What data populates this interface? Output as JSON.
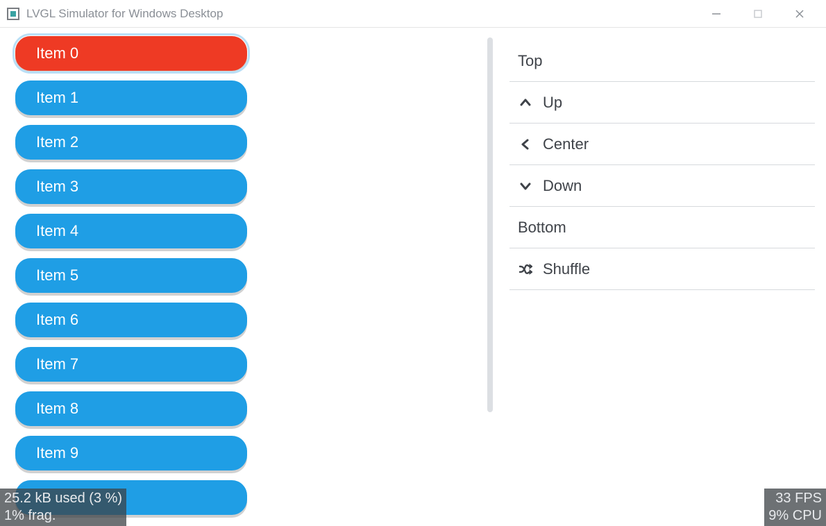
{
  "window": {
    "title": "LVGL Simulator for Windows Desktop"
  },
  "list": {
    "items": [
      {
        "label": "Item 0",
        "selected": true
      },
      {
        "label": "Item 1",
        "selected": false
      },
      {
        "label": "Item 2",
        "selected": false
      },
      {
        "label": "Item 3",
        "selected": false
      },
      {
        "label": "Item 4",
        "selected": false
      },
      {
        "label": "Item 5",
        "selected": false
      },
      {
        "label": "Item 6",
        "selected": false
      },
      {
        "label": "Item 7",
        "selected": false
      },
      {
        "label": "Item 8",
        "selected": false
      },
      {
        "label": "Item 9",
        "selected": false
      }
    ]
  },
  "actions": {
    "top": {
      "label": "Top",
      "icon": null
    },
    "up": {
      "label": "Up",
      "icon": "chevron-up"
    },
    "center": {
      "label": "Center",
      "icon": "chevron-left"
    },
    "down": {
      "label": "Down",
      "icon": "chevron-down"
    },
    "bottom": {
      "label": "Bottom",
      "icon": null
    },
    "shuffle": {
      "label": "Shuffle",
      "icon": "shuffle"
    }
  },
  "status": {
    "mem_line1": "25.2 kB used (3 %)",
    "mem_line2": "1% frag.",
    "fps_line1": "33 FPS",
    "fps_line2": "9% CPU"
  },
  "colors": {
    "button": "#1f9ee5",
    "button_selected": "#ee3a24",
    "focus_ring": "#b9dff6",
    "divider": "#d6d9dd",
    "text_dark": "#3f4349"
  }
}
